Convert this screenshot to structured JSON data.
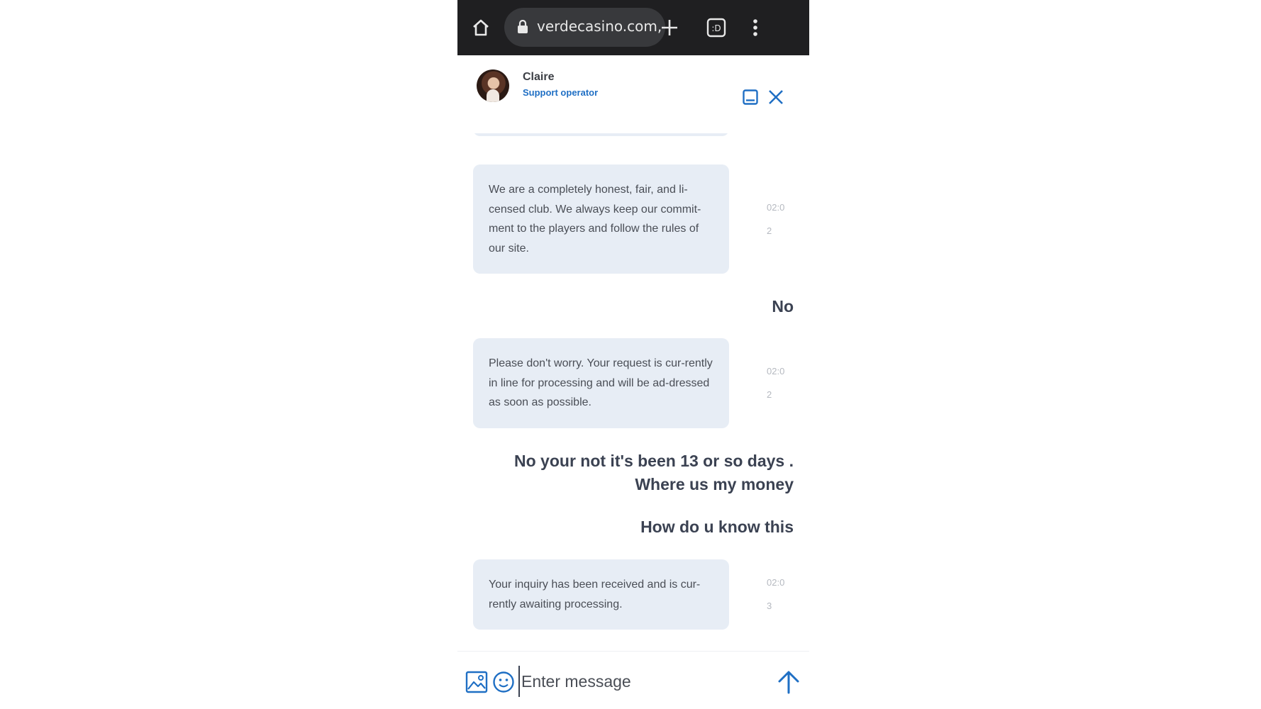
{
  "browser": {
    "url": "verdecasino.com,",
    "tab_count_glyph": ":D",
    "icons": [
      "home-icon",
      "lock-icon",
      "new-tab-icon",
      "tab-switcher-icon",
      "more-vert-icon"
    ]
  },
  "header": {
    "operator_name": "Claire",
    "operator_role": "Support operator",
    "icons": [
      "avatar",
      "minimize-icon",
      "close-icon"
    ]
  },
  "messages": [
    {
      "from": "operator",
      "text": "We are a completely honest, fair, and li-censed club. We always keep our commit-ment to the players and follow the rules of our site.",
      "time_line1": "02:0",
      "time_line2": "2"
    },
    {
      "from": "user",
      "text": "No"
    },
    {
      "from": "operator",
      "text": "Please don't worry. Your request is cur-rently in line for processing and will be ad-dressed as soon as possible.",
      "time_line1": "02:0",
      "time_line2": "2"
    },
    {
      "from": "user",
      "text": "No your not it's been 13 or so days . Where us my money"
    },
    {
      "from": "user",
      "text": "How do u know this"
    },
    {
      "from": "operator",
      "text": "Your inquiry has been received and is cur-rently awaiting processing.",
      "time_line1": "02:0",
      "time_line2": "3"
    }
  ],
  "composer": {
    "placeholder": "Enter message",
    "icons": [
      "image-attach-icon",
      "emoji-icon",
      "send-arrow-icon"
    ]
  },
  "colors": {
    "accent": "#1f6fc4",
    "bubble": "#e7edf5",
    "browser_bar": "#1f1f21",
    "user_text": "#3b4252"
  }
}
